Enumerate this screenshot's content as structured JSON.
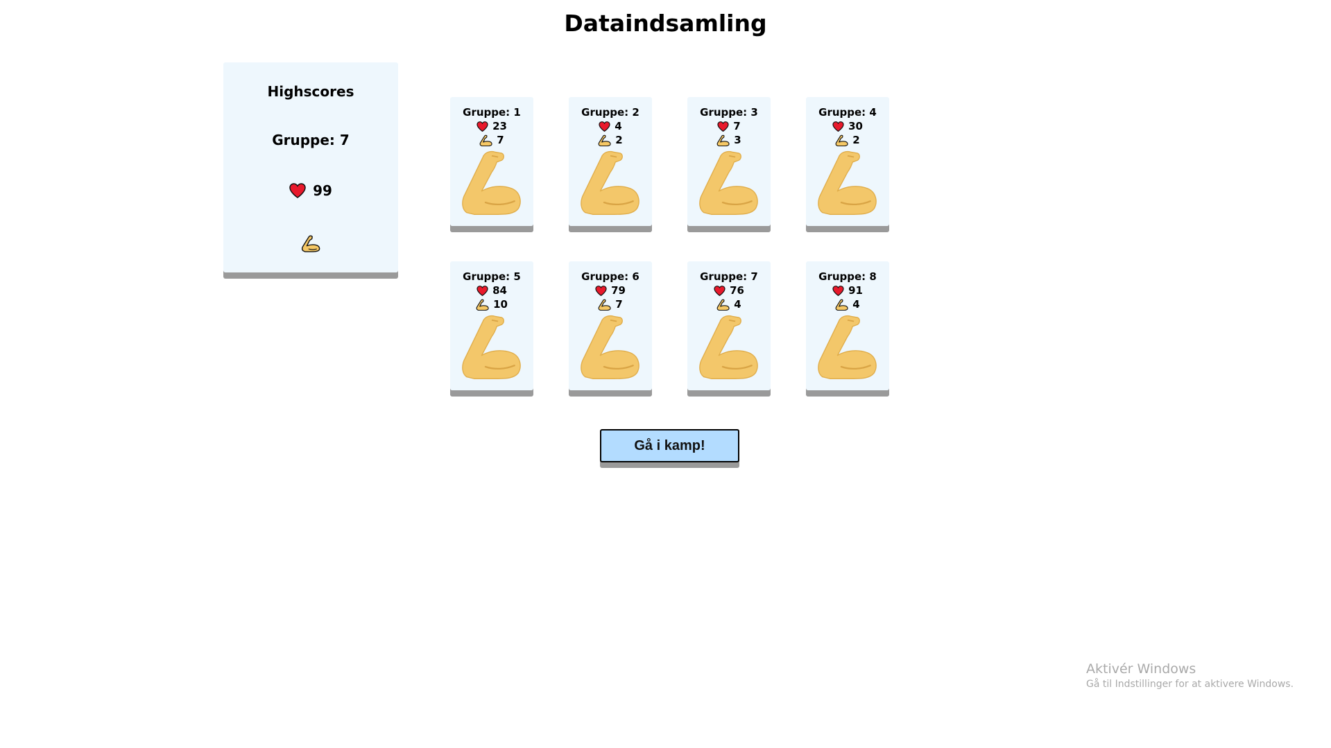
{
  "page": {
    "title": "Dataindsamling"
  },
  "highscore": {
    "title": "Highscores",
    "group_label": "Gruppe: 7",
    "hearts": "99",
    "heart_icon": "heart-icon",
    "arm_icon": "flexed-biceps-icon"
  },
  "cards": [
    {
      "label": "Gruppe: 1",
      "hp": "23",
      "power": "7"
    },
    {
      "label": "Gruppe: 2",
      "hp": "4",
      "power": "2"
    },
    {
      "label": "Gruppe: 3",
      "hp": "7",
      "power": "3"
    },
    {
      "label": "Gruppe: 4",
      "hp": "30",
      "power": "2"
    },
    {
      "label": "Gruppe: 5",
      "hp": "84",
      "power": "10"
    },
    {
      "label": "Gruppe: 6",
      "hp": "79",
      "power": "7"
    },
    {
      "label": "Gruppe: 7",
      "hp": "76",
      "power": "4"
    },
    {
      "label": "Gruppe: 8",
      "hp": "91",
      "power": "4"
    }
  ],
  "actions": {
    "fight_label": "Gå i kamp!"
  },
  "watermark": {
    "title": "Aktivér Windows",
    "subtitle": "Gå til Indstillinger for at aktivere Windows."
  },
  "colors": {
    "card_bg": "#eef7fd",
    "button_bg": "#b3dcff",
    "heart": "#e8192c",
    "arm": "#f5c866"
  }
}
